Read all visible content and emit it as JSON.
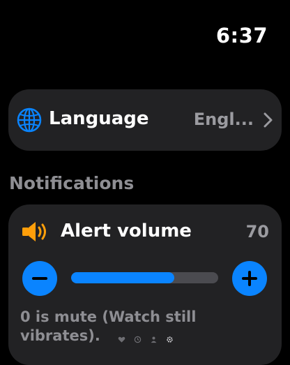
{
  "status_bar": {
    "time": "6:37"
  },
  "language_row": {
    "icon": "globe-icon",
    "label": "Language",
    "value": "Engl...",
    "chevron_icon": "chevron-right-icon"
  },
  "notifications": {
    "section_title": "Notifications",
    "alert_volume": {
      "icon": "speaker-icon",
      "label": "Alert volume",
      "value": "70",
      "level_percent": 70,
      "decrease_icon": "minus-icon",
      "increase_icon": "plus-icon"
    },
    "hint": "0 is mute (Watch still vibrates)."
  },
  "page_indicators": [
    "heart-icon",
    "clock-icon",
    "person-icon",
    "settings-icon"
  ],
  "colors": {
    "accent": "#0a84ff",
    "speaker": "#ff9f0a",
    "card": "#222224",
    "secondary_text": "#8e8e93"
  }
}
